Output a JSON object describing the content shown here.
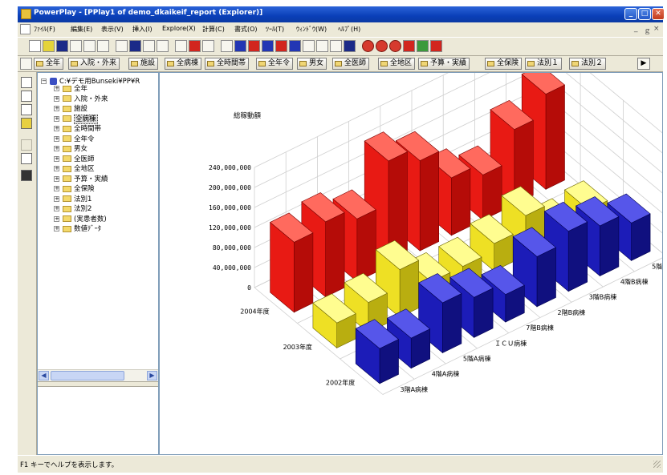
{
  "window": {
    "title": "PowerPlay - [PPlay1 of demo_dkaikeif_report (Explorer)]",
    "min_label": "_",
    "max_label": "□",
    "close_label": "✕"
  },
  "menu": {
    "items": [
      "ﾌｧｲﾙ(F)",
      "編集(E)",
      "表示(V)",
      "挿入(I)",
      "Explore(X)",
      "計算(C)",
      "書式(O)",
      "ﾂｰﾙ(T)",
      "ｳｨﾝﾄﾞｳ(W)",
      "ﾍﾙﾌﾟ(H)"
    ],
    "mdi_min": "_",
    "mdi_restore": "ｇ",
    "mdi_close": "×"
  },
  "dimbar": {
    "tabs": [
      "全年",
      "入院・外来",
      "施設",
      "全病棟",
      "全時間帯",
      "全年令",
      "男女",
      "全医師",
      "全地区",
      "予算・実績",
      "全保険",
      "法別１",
      "法別２"
    ],
    "arrow": "▶"
  },
  "tree": {
    "root": "C:¥デモ用Bunseki¥PP¥R",
    "items": [
      "全年",
      "入院・外来",
      "施設",
      "全病棟",
      "全時間帯",
      "全年令",
      "男女",
      "全医師",
      "全地区",
      "予算・実績",
      "全保険",
      "法別1",
      "法別2",
      "(実患者数)",
      "数値ﾃﾞｰﾀ"
    ],
    "selected_index": 3
  },
  "status": {
    "text": "F1 キーでヘルプを表示します。"
  },
  "colors": {
    "series1": "#e41a14",
    "series2": "#e8e024",
    "series3": "#1a1ab4"
  },
  "chart_data": {
    "type": "bar",
    "title": "総稼動額",
    "ylim": [
      0,
      240000000
    ],
    "yticks": [
      "0",
      "40,000,000",
      "80,000,000",
      "120,000,000",
      "160,000,000",
      "200,000,000",
      "240,000,000"
    ],
    "categories": [
      "3階A病棟",
      "4階A病棟",
      "5階A病棟",
      "ＩＣＵ病棟",
      "7階B病棟",
      "2階B病棟",
      "3階B病棟",
      "4階B病棟",
      "5階B病棟"
    ],
    "series": [
      {
        "name": "2004年度",
        "values": [
          140000000,
          150000000,
          125000000,
          210000000,
          180000000,
          115000000,
          90000000,
          150000000,
          190000000
        ]
      },
      {
        "name": "2003年度",
        "values": [
          50000000,
          60000000,
          95000000,
          40000000,
          40000000,
          55000000,
          80000000,
          25000000,
          30000000
        ]
      },
      {
        "name": "2002年度",
        "values": [
          70000000,
          60000000,
          100000000,
          80000000,
          55000000,
          100000000,
          120000000,
          100000000,
          75000000
        ]
      }
    ]
  }
}
